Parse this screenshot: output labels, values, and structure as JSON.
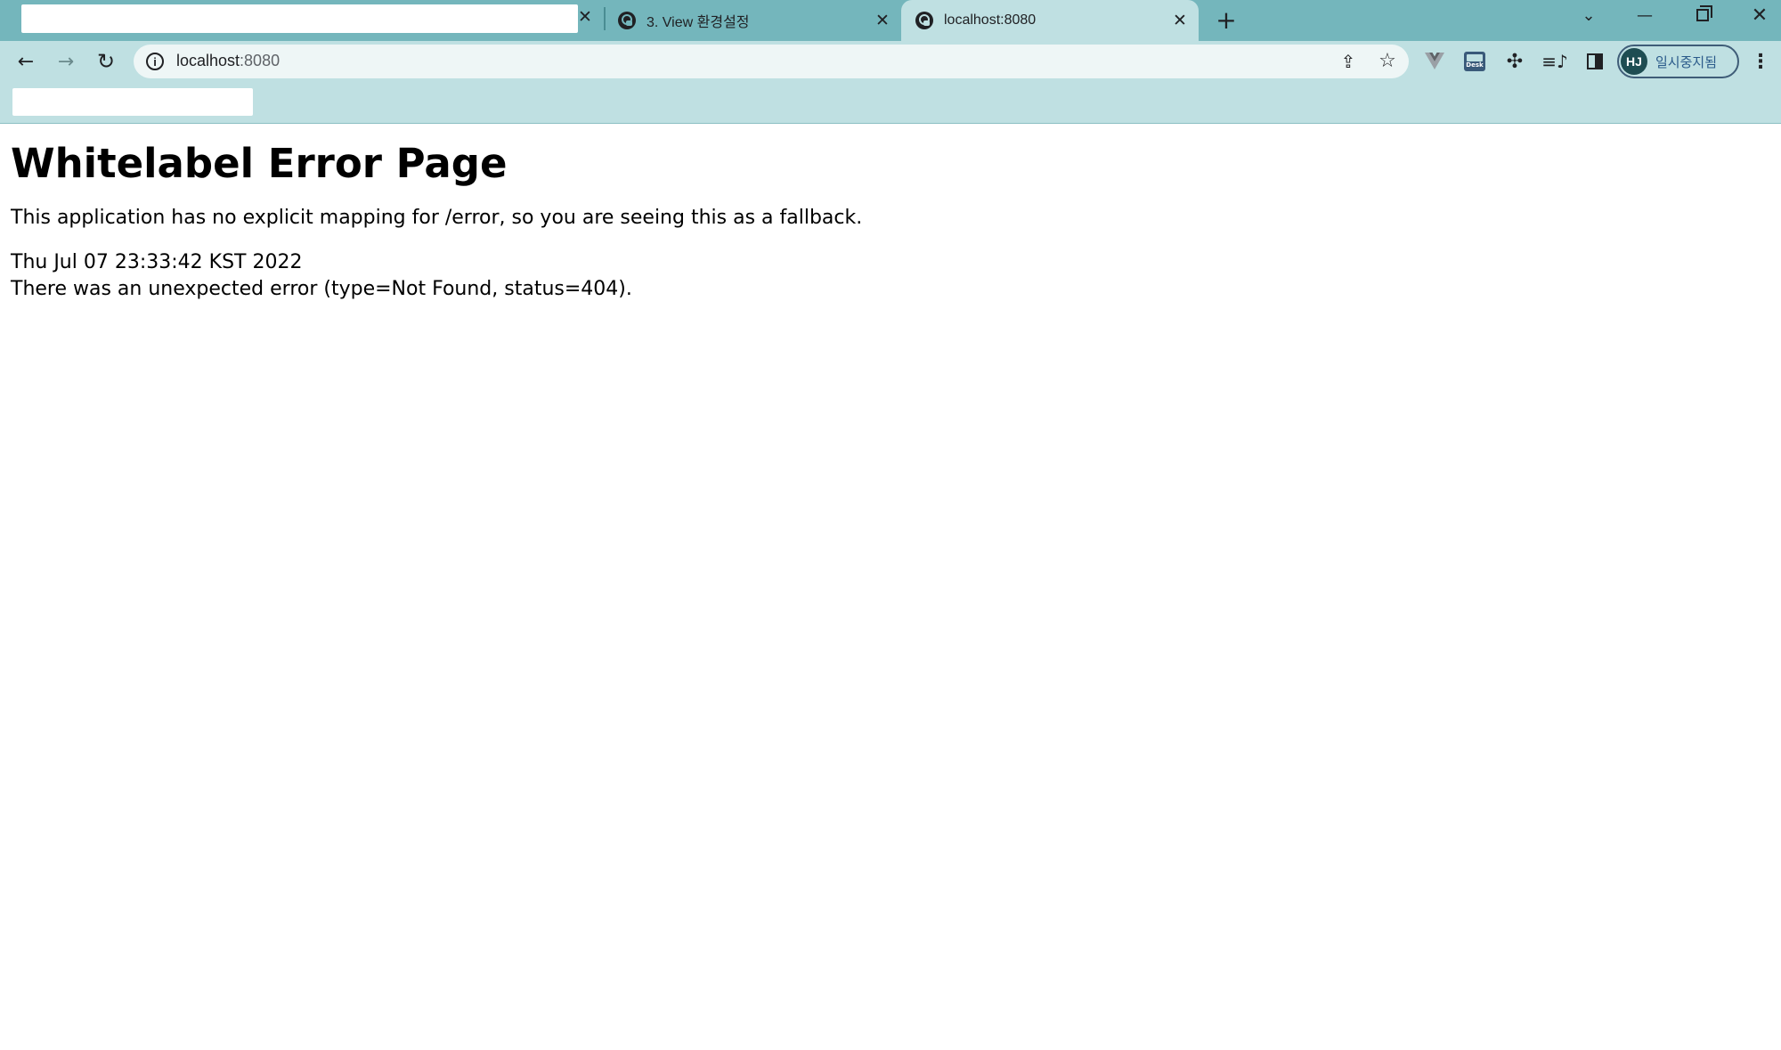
{
  "browser": {
    "tabs": [
      {
        "title": "",
        "active": false,
        "redacted": true
      },
      {
        "title": "3. View 환경설정",
        "active": false
      },
      {
        "title": "localhost:8080",
        "active": true
      }
    ],
    "address_bar": {
      "host": "localhost",
      "port": ":8080"
    },
    "profile": {
      "initials": "HJ",
      "status": "일시중지됨"
    },
    "colors": {
      "tab_strip": "#74b6bc",
      "toolbar": "#bfe0e2",
      "omnibox": "#eef6f6",
      "profile_border": "#3f5d78"
    }
  },
  "page": {
    "title": "Whitelabel Error Page",
    "fallback_message": "This application has no explicit mapping for /error, so you are seeing this as a fallback.",
    "timestamp": "Thu Jul 07 23:33:42 KST 2022",
    "error_message": "There was an unexpected error (type=Not Found, status=404)."
  }
}
